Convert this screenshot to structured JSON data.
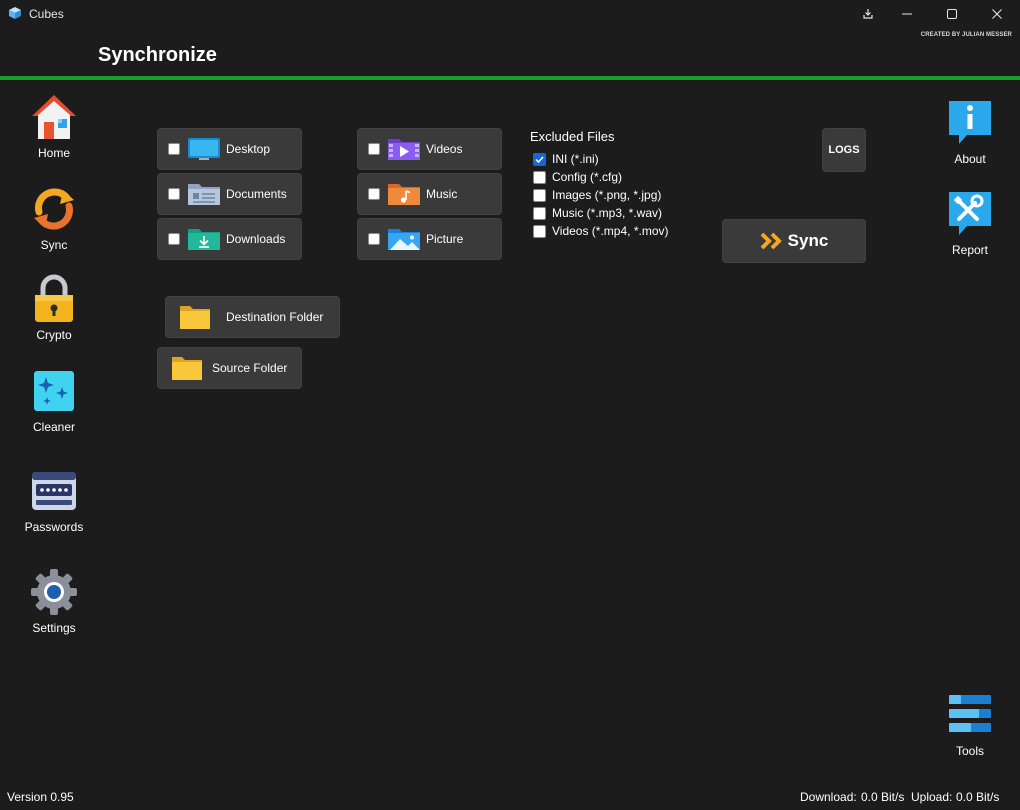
{
  "window": {
    "title": "Cubes",
    "created_by": "CREATED BY JULIAN MESSER",
    "controls": [
      "pin-icon",
      "minimize-icon",
      "maximize-icon",
      "close-icon"
    ]
  },
  "header": {
    "title": "Synchronize",
    "accent_color": "#16a02c"
  },
  "left_nav": [
    {
      "label": "Home",
      "icon": "home-icon"
    },
    {
      "label": "Sync",
      "icon": "sync-icon"
    },
    {
      "label": "Crypto",
      "icon": "lock-icon"
    },
    {
      "label": "Cleaner",
      "icon": "sparkle-icon"
    },
    {
      "label": "Passwords",
      "icon": "password-icon"
    },
    {
      "label": "Settings",
      "icon": "gear-icon"
    }
  ],
  "right_nav": [
    {
      "label": "About",
      "icon": "info-icon"
    },
    {
      "label": "Report",
      "icon": "tools-icon"
    },
    {
      "label": "Tools",
      "icon": "toolbox-icon"
    }
  ],
  "folders_col1": [
    {
      "label": "Desktop",
      "icon": "desktop-icon",
      "checked": false
    },
    {
      "label": "Documents",
      "icon": "documents-icon",
      "checked": false
    },
    {
      "label": "Downloads",
      "icon": "downloads-icon",
      "checked": false
    }
  ],
  "folders_col2": [
    {
      "label": "Videos",
      "icon": "videos-icon",
      "checked": false
    },
    {
      "label": "Music",
      "icon": "music-icon",
      "checked": false
    },
    {
      "label": "Picture",
      "icon": "picture-icon",
      "checked": false
    }
  ],
  "folder_buttons": {
    "destination": "Destination Folder",
    "source": "Source Folder"
  },
  "excluded": {
    "title": "Excluded Files",
    "items": [
      {
        "label": "INI (*.ini)",
        "checked": true
      },
      {
        "label": "Config (*.cfg)",
        "checked": false
      },
      {
        "label": "Images (*.png, *.jpg)",
        "checked": false
      },
      {
        "label": "Music (*.mp3, *.wav)",
        "checked": false
      },
      {
        "label": "Videos (*.mp4, *.mov)",
        "checked": false
      }
    ]
  },
  "buttons": {
    "logs": "LOGS",
    "sync": "Sync"
  },
  "footer": {
    "version": "Version 0.95",
    "download_label": "Download:",
    "download_value": "0.0 Bit/s",
    "upload_label": "Upload:",
    "upload_value": "0.0 Bit/s"
  }
}
